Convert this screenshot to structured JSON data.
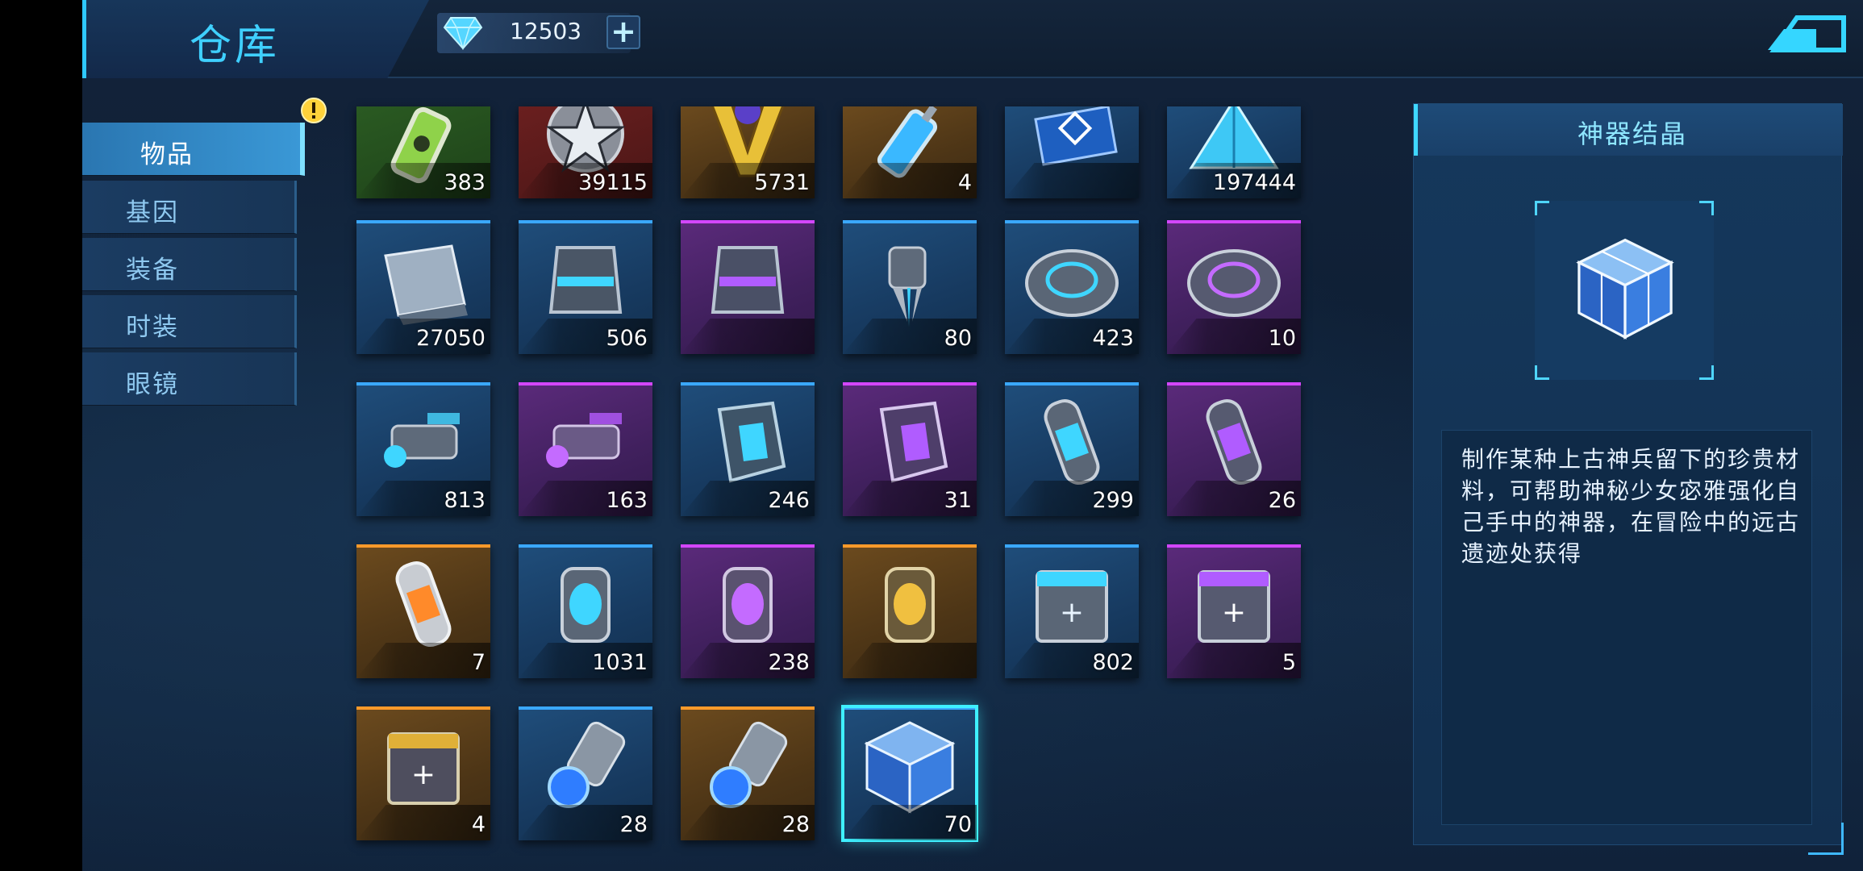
{
  "header": {
    "title": "仓库",
    "gems": "12503",
    "add_label": "+"
  },
  "sidebar": {
    "tabs": [
      {
        "label": "物品",
        "active": true
      },
      {
        "label": "基因",
        "active": false
      },
      {
        "label": "装备",
        "active": false
      },
      {
        "label": "时装",
        "active": false
      },
      {
        "label": "眼镜",
        "active": false
      }
    ]
  },
  "inventory": {
    "items": [
      {
        "count": "383",
        "quality": "green",
        "icon": "green-canister-icon"
      },
      {
        "count": "39115",
        "quality": "red",
        "icon": "star-badge-icon"
      },
      {
        "count": "5731",
        "quality": "orange",
        "icon": "gold-emblem-icon"
      },
      {
        "count": "4",
        "quality": "orange",
        "icon": "blue-syringe-icon"
      },
      {
        "count": "",
        "quality": "blue",
        "icon": "card-icon"
      },
      {
        "count": "197444",
        "quality": "blue",
        "icon": "blue-pyramid-icon"
      },
      {
        "count": "27050",
        "quality": "blue",
        "icon": "metal-plate-icon"
      },
      {
        "count": "506",
        "quality": "blue",
        "icon": "armor-part-icon"
      },
      {
        "count": "",
        "quality": "purple",
        "icon": "armor-part-icon"
      },
      {
        "count": "80",
        "quality": "blue",
        "icon": "claw-part-icon"
      },
      {
        "count": "423",
        "quality": "blue",
        "icon": "disc-icon"
      },
      {
        "count": "10",
        "quality": "purple",
        "icon": "disc-icon"
      },
      {
        "count": "813",
        "quality": "blue",
        "icon": "gun-part-icon"
      },
      {
        "count": "163",
        "quality": "purple",
        "icon": "gun-part-icon"
      },
      {
        "count": "246",
        "quality": "blue",
        "icon": "shard-icon"
      },
      {
        "count": "31",
        "quality": "purple",
        "icon": "shard-icon"
      },
      {
        "count": "299",
        "quality": "blue",
        "icon": "capsule-icon"
      },
      {
        "count": "26",
        "quality": "purple",
        "icon": "capsule-icon"
      },
      {
        "count": "7",
        "quality": "orange",
        "icon": "capsule-icon"
      },
      {
        "count": "1031",
        "quality": "blue",
        "icon": "lantern-icon"
      },
      {
        "count": "238",
        "quality": "purple",
        "icon": "lantern-icon"
      },
      {
        "count": "",
        "quality": "orange",
        "icon": "lantern-icon"
      },
      {
        "count": "802",
        "quality": "blue",
        "icon": "supply-crate-icon"
      },
      {
        "count": "5",
        "quality": "purple",
        "icon": "supply-crate-icon"
      },
      {
        "count": "4",
        "quality": "orange",
        "icon": "supply-crate-icon"
      },
      {
        "count": "28",
        "quality": "blue",
        "icon": "energy-core-icon"
      },
      {
        "count": "28",
        "quality": "orange",
        "icon": "energy-core-icon"
      },
      {
        "count": "70",
        "quality": "blue",
        "icon": "crystal-cube-icon",
        "selected": true
      }
    ]
  },
  "detail": {
    "title": "神器结晶",
    "icon": "crystal-cube-icon",
    "description": "制作某种上古神兵留下的珍贵材料，可帮助神秘少女宓雅强化自己手中的神器，在冒险中的远古遗迹处获得"
  },
  "colors": {
    "accent": "#3fd0ff",
    "blue_quality": "#3aa8ff",
    "purple_quality": "#d346ff",
    "orange_quality": "#ff9a2a"
  }
}
